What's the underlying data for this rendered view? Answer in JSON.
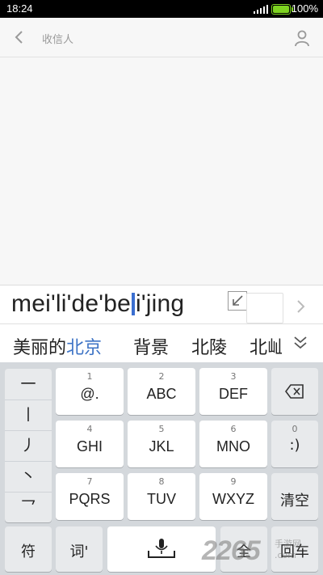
{
  "status_bar": {
    "time": "18:24",
    "battery": "100%",
    "signal_icon": "signal-icon",
    "battery_icon": "battery-icon"
  },
  "header": {
    "back_icon": "chevron-left-icon",
    "recipient_placeholder": "收信人",
    "contact_icon": "person-icon"
  },
  "composition": {
    "pinyin_before": "mei'li'de'be",
    "pinyin_after": "i'jing",
    "collapse_icon": "collapse-arrow-icon",
    "send_icon": "chevron-right-icon"
  },
  "candidates": {
    "items": [
      {
        "normal": "美丽的",
        "highlight": "北京"
      },
      {
        "normal": "背景",
        "highlight": ""
      },
      {
        "normal": "北陵",
        "highlight": ""
      },
      {
        "normal": "北屾",
        "highlight": ""
      }
    ],
    "more_icon": "chevron-double-down-icon"
  },
  "keyboard": {
    "strokes": [
      "一",
      "丨",
      "丿",
      "丶",
      "乛"
    ],
    "keys": [
      {
        "num": "1",
        "label": "@."
      },
      {
        "num": "2",
        "label": "ABC"
      },
      {
        "num": "3",
        "label": "DEF"
      },
      {
        "num": "4",
        "label": "GHI"
      },
      {
        "num": "5",
        "label": "JKL"
      },
      {
        "num": "6",
        "label": "MNO"
      },
      {
        "num": "7",
        "label": "PQRS"
      },
      {
        "num": "8",
        "label": "TUV"
      },
      {
        "num": "9",
        "label": "WXYZ"
      }
    ],
    "backspace_icon": "backspace-icon",
    "zero_key": {
      "num": "0",
      "label": ":)"
    },
    "clear": "清空",
    "symbol": "符",
    "word": "词'",
    "mic_icon": "microphone-icon",
    "fullwidth": "全",
    "enter": "回车"
  },
  "watermark": {
    "text": "2265",
    "sub": "手游网",
    "com": ".com"
  }
}
